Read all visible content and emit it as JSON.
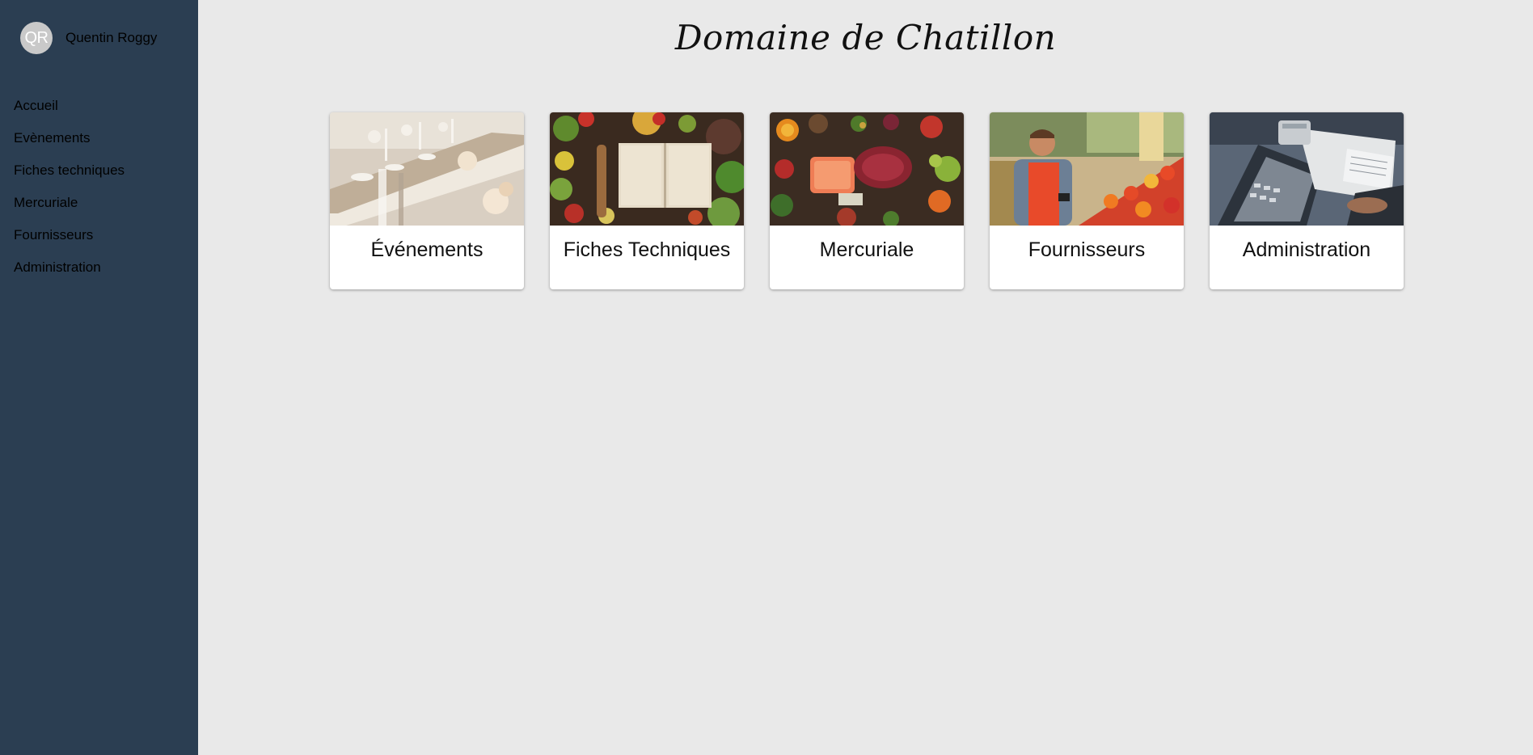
{
  "user": {
    "initials": "QR",
    "name": "Quentin Roggy"
  },
  "nav": {
    "items": [
      {
        "label": "Accueil"
      },
      {
        "label": "Evènements"
      },
      {
        "label": "Fiches techniques"
      },
      {
        "label": "Mercuriale"
      },
      {
        "label": "Fournisseurs"
      },
      {
        "label": "Administration"
      }
    ]
  },
  "header": {
    "title": "Domaine de Chatillon"
  },
  "cards": [
    {
      "title": "Événements",
      "image": "banquet-table-photo"
    },
    {
      "title": "Fiches Techniques",
      "image": "vegetables-open-book-photo"
    },
    {
      "title": "Mercuriale",
      "image": "fresh-produce-meat-fish-photo"
    },
    {
      "title": "Fournisseurs",
      "image": "grocer-with-phone-photo"
    },
    {
      "title": "Administration",
      "image": "laptop-calculator-paperwork-photo"
    }
  ],
  "colors": {
    "sidebar": "#2b3e52",
    "background": "#e9e9e9",
    "card": "#ffffff"
  }
}
